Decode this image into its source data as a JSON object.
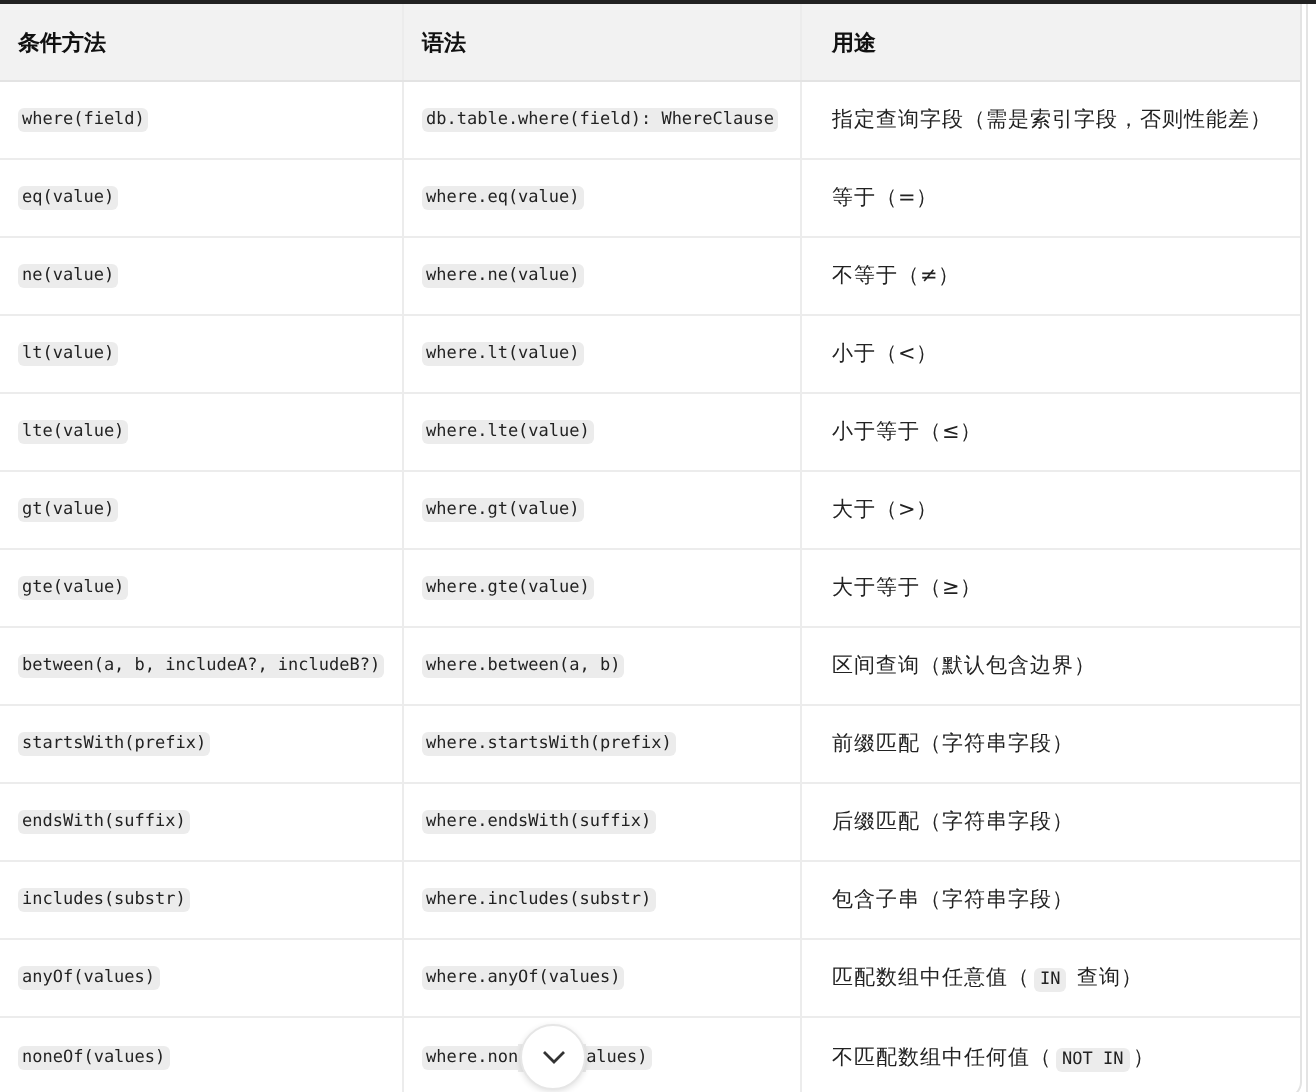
{
  "table": {
    "columns": [
      "条件方法",
      "语法",
      "用途"
    ],
    "rows": [
      {
        "method": "where(field)",
        "syntax": [
          "db.table.where(field): WhereClause"
        ],
        "usage": [
          {
            "text": "指定查询字段（需是索引字段，否则性能差）"
          }
        ]
      },
      {
        "method": "eq(value)",
        "syntax": [
          "where.eq(value)"
        ],
        "usage": [
          {
            "text": "等于（=）"
          }
        ]
      },
      {
        "method": "ne(value)",
        "syntax": [
          "where.ne(value)"
        ],
        "usage": [
          {
            "text": "不等于（≠）"
          }
        ]
      },
      {
        "method": "lt(value)",
        "syntax": [
          "where.lt(value)"
        ],
        "usage": [
          {
            "text": "小于（<）"
          }
        ]
      },
      {
        "method": "lte(value)",
        "syntax": [
          "where.lte(value)"
        ],
        "usage": [
          {
            "text": "小于等于（≤）"
          }
        ]
      },
      {
        "method": "gt(value)",
        "syntax": [
          "where.gt(value)"
        ],
        "usage": [
          {
            "text": "大于（>）"
          }
        ]
      },
      {
        "method": "gte(value)",
        "syntax": [
          "where.gte(value)"
        ],
        "usage": [
          {
            "text": "大于等于（≥）"
          }
        ]
      },
      {
        "method": "between(a, b, includeA?, includeB?)",
        "syntax": [
          "where.between(a, b)"
        ],
        "usage": [
          {
            "text": "区间查询（默认包含边界）"
          }
        ]
      },
      {
        "method": "startsWith(prefix)",
        "syntax": [
          "where.startsWith(prefix)"
        ],
        "usage": [
          {
            "text": "前缀匹配（字符串字段）"
          }
        ]
      },
      {
        "method": "endsWith(suffix)",
        "syntax": [
          "where.endsWith(suffix)"
        ],
        "usage": [
          {
            "text": "后缀匹配（字符串字段）"
          }
        ]
      },
      {
        "method": "includes(substr)",
        "syntax": [
          "where.includes(substr)"
        ],
        "usage": [
          {
            "text": "包含子串（字符串字段）"
          }
        ]
      },
      {
        "method": "anyOf(values)",
        "syntax": [
          "where.anyOf(values)"
        ],
        "usage": [
          {
            "text": "匹配数组中任意值（"
          },
          {
            "code": "IN"
          },
          {
            "text": " 查询）"
          }
        ]
      },
      {
        "method": "noneOf(values)",
        "syntax": [
          "where.non",
          "alues)"
        ],
        "usage": [
          {
            "text": "不匹配数组中任何值（"
          },
          {
            "code": "NOT IN"
          },
          {
            "text": "）"
          }
        ]
      }
    ]
  },
  "scroll_down_button": {
    "kind": "chevron"
  }
}
